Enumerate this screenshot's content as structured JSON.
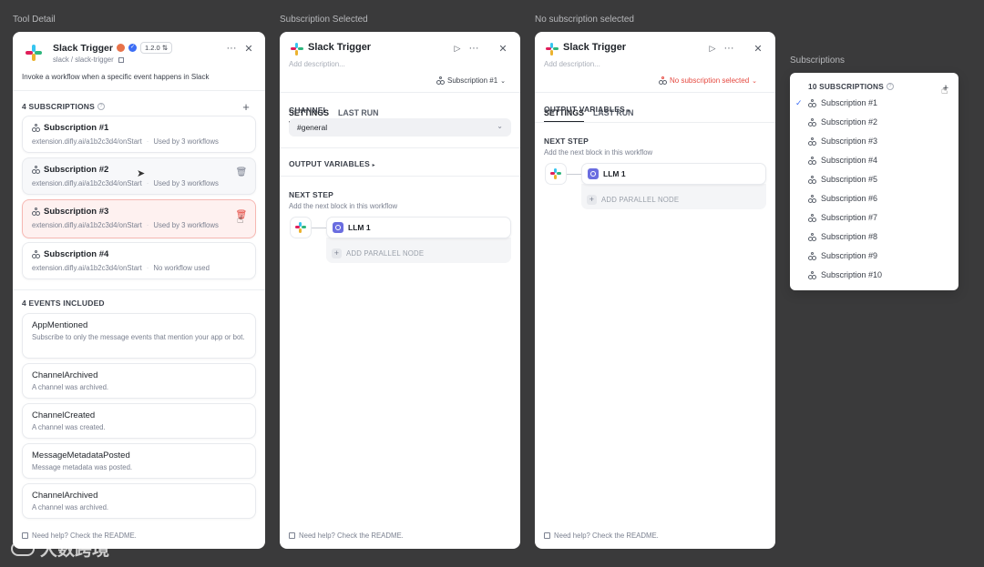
{
  "labels": {
    "tool_detail": "Tool Detail",
    "subscription_selected": "Subscription Selected",
    "no_subscription_selected": "No subscription selected",
    "subscriptions": "Subscriptions"
  },
  "tool_detail": {
    "title": "Slack Trigger",
    "version": "1.2.0",
    "path": "slack / slack-trigger",
    "description": "Invoke a workflow when a specific event happens in Slack",
    "subscriptions_heading": "4 SUBSCRIPTIONS",
    "subscriptions": [
      {
        "name": "Subscription #1",
        "url": "extension.difly.ai/a1b2c3d4/onStart",
        "usage": "Used by 3 workflows"
      },
      {
        "name": "Subscription #2",
        "url": "extension.difly.ai/a1b2c3d4/onStart",
        "usage": "Used by 3 workflows"
      },
      {
        "name": "Subscription #3",
        "url": "extension.difly.ai/a1b2c3d4/onStart",
        "usage": "Used by 3 workflows"
      },
      {
        "name": "Subscription #4",
        "url": "extension.difly.ai/a1b2c3d4/onStart",
        "usage": "No workflow used"
      }
    ],
    "events_heading": "4 EVENTS INCLUDED",
    "events": [
      {
        "name": "AppMentioned",
        "desc": "Subscribe to only the message events that mention your app or bot."
      },
      {
        "name": "ChannelArchived",
        "desc": "A channel was archived."
      },
      {
        "name": "ChannelCreated",
        "desc": "A channel was created."
      },
      {
        "name": "MessageMetadataPosted",
        "desc": "Message metadata was posted."
      },
      {
        "name": "ChannelArchived",
        "desc": "A channel was archived."
      }
    ],
    "help": "Need help? Check the README."
  },
  "selected_panel": {
    "title": "Slack Trigger",
    "desc_placeholder": "Add description...",
    "tab_settings": "SETTINGS",
    "tab_last_run": "LAST RUN",
    "subscription_select": "Subscription #1",
    "channel_label": "CHANNEL",
    "channel_value": "#general",
    "output_variables": "OUTPUT VARIABLES",
    "next_step": "NEXT STEP",
    "next_step_desc": "Add the next block in this workflow",
    "llm_node": "LLM 1",
    "add_parallel": "ADD PARALLEL NODE",
    "help": "Need help? Check the README."
  },
  "none_panel": {
    "title": "Slack Trigger",
    "desc_placeholder": "Add description...",
    "tab_settings": "SETTINGS",
    "tab_last_run": "LAST RUN",
    "subscription_select": "No subscription selected",
    "output_variables": "OUTPUT VARIABLES",
    "next_step": "NEXT STEP",
    "next_step_desc": "Add the next block in this workflow",
    "llm_node": "LLM 1",
    "add_parallel": "ADD PARALLEL NODE",
    "help": "Need help? Check the README."
  },
  "dropdown": {
    "heading": "10 SUBSCRIPTIONS",
    "items": [
      "Subscription #1",
      "Subscription #2",
      "Subscription #3",
      "Subscription #4",
      "Subscription #5",
      "Subscription #6",
      "Subscription #7",
      "Subscription #8",
      "Subscription #9",
      "Subscription #10"
    ]
  },
  "watermark": "大数跨境",
  "colors": {
    "accent": "#3d6ef5",
    "danger": "#e5483f",
    "llm": "#6a6de0"
  }
}
